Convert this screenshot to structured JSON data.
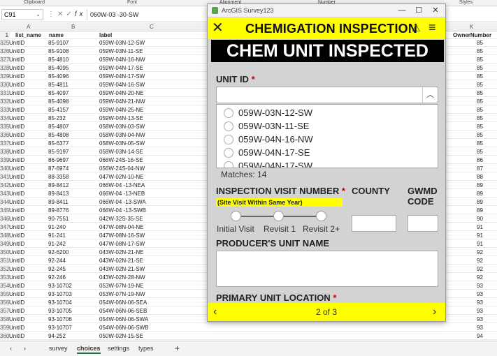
{
  "excel": {
    "ribbon_groups": [
      "Clipboard",
      "Font",
      "Alignment",
      "Number",
      "Styles"
    ],
    "name_box": "C91",
    "formula": "060W-03 -30-SW",
    "fx_label": "fx",
    "columns": [
      "A",
      "B",
      "C",
      "K"
    ],
    "header_row": {
      "rownum": "1",
      "list_name": "list_name",
      "name": "name",
      "label": "label",
      "owner": "OwnerNumber"
    },
    "rows": [
      {
        "n": "325",
        "a": "UnitID",
        "b": "85-9107",
        "c": "059W-03N-12-SW",
        "k": "85"
      },
      {
        "n": "326",
        "a": "UnitID",
        "b": "85-9108",
        "c": "059W-03N-11-SE",
        "k": "85"
      },
      {
        "n": "327",
        "a": "UnitID",
        "b": "85-4810",
        "c": "059W-04N-16-NW",
        "k": "85"
      },
      {
        "n": "328",
        "a": "UnitID",
        "b": "85-4095",
        "c": "059W-04N-17-SE",
        "k": "85"
      },
      {
        "n": "329",
        "a": "UnitID",
        "b": "85-4096",
        "c": "059W-04N-17-SW",
        "k": "85"
      },
      {
        "n": "330",
        "a": "UnitID",
        "b": "85-4811",
        "c": "059W-04N-16-SW",
        "k": "85"
      },
      {
        "n": "331",
        "a": "UnitID",
        "b": "85-4097",
        "c": "059W-04N-20-NE",
        "k": "85"
      },
      {
        "n": "332",
        "a": "UnitID",
        "b": "85-4098",
        "c": "059W-04N-21-NW",
        "k": "85"
      },
      {
        "n": "333",
        "a": "UnitID",
        "b": "85-4157",
        "c": "059W-04N-25-NE",
        "k": "85"
      },
      {
        "n": "334",
        "a": "UnitID",
        "b": "85-232",
        "c": "059W-04N-13-SE",
        "k": "85"
      },
      {
        "n": "335",
        "a": "UnitID",
        "b": "85-4807",
        "c": "058W-03N-03-SW",
        "k": "85"
      },
      {
        "n": "336",
        "a": "UnitID",
        "b": "85-4808",
        "c": "058W-03N-04-NW",
        "k": "85"
      },
      {
        "n": "337",
        "a": "UnitID",
        "b": "85-6377",
        "c": "058W-03N-05-SW",
        "k": "85"
      },
      {
        "n": "338",
        "a": "UnitID",
        "b": "85-9197",
        "c": "058W-03N-14-SE",
        "k": "85"
      },
      {
        "n": "339",
        "a": "UnitID",
        "b": "86-9697",
        "c": "066W-24S-16-SE",
        "k": "86"
      },
      {
        "n": "340",
        "a": "UnitID",
        "b": "87-6974",
        "c": "056W-24S-04-NW",
        "k": "87"
      },
      {
        "n": "341",
        "a": "UnitID",
        "b": "88-3358",
        "c": "047W-02N-10-NE",
        "k": "88"
      },
      {
        "n": "342",
        "a": "UnitID",
        "b": "89-8412",
        "c": "066W-04 -13-NEA",
        "k": "89"
      },
      {
        "n": "343",
        "a": "UnitID",
        "b": "89-8413",
        "c": "066W-04 -13-NEB",
        "k": "89"
      },
      {
        "n": "344",
        "a": "UnitID",
        "b": "89-8411",
        "c": "066W-04 -13-SWA",
        "k": "89"
      },
      {
        "n": "345",
        "a": "UnitID",
        "b": "89-8776",
        "c": "066W-04 -13-SWB",
        "k": "89"
      },
      {
        "n": "346",
        "a": "UnitID",
        "b": "90-7551",
        "c": "042W-32S-35-SE",
        "k": "90"
      },
      {
        "n": "347",
        "a": "UnitID",
        "b": "91-240",
        "c": "047W-08N-04-NE",
        "k": "91"
      },
      {
        "n": "348",
        "a": "UnitID",
        "b": "91-241",
        "c": "047W-08N-16-SW",
        "k": "91"
      },
      {
        "n": "349",
        "a": "UnitID",
        "b": "91-242",
        "c": "047W-08N-17-SW",
        "k": "91"
      },
      {
        "n": "350",
        "a": "UnitID",
        "b": "92-6200",
        "c": "043W-02N-21-NE",
        "k": "92"
      },
      {
        "n": "351",
        "a": "UnitID",
        "b": "92-244",
        "c": "043W-02N-21-SE",
        "k": "92"
      },
      {
        "n": "352",
        "a": "UnitID",
        "b": "92-245",
        "c": "043W-02N-21-SW",
        "k": "92"
      },
      {
        "n": "353",
        "a": "UnitID",
        "b": "92-246",
        "c": "043W-02N-28-NW",
        "k": "92"
      },
      {
        "n": "354",
        "a": "UnitID",
        "b": "93-10702",
        "c": "053W-07N-19-NE",
        "k": "93"
      },
      {
        "n": "355",
        "a": "UnitID",
        "b": "93-10703",
        "c": "053W-07N-19-NW",
        "k": "93"
      },
      {
        "n": "356",
        "a": "UnitID",
        "b": "93-10704",
        "c": "054W-06N-06-SEA",
        "k": "93"
      },
      {
        "n": "357",
        "a": "UnitID",
        "b": "93-10705",
        "c": "054W-06N-06-SEB",
        "k": "93"
      },
      {
        "n": "358",
        "a": "UnitID",
        "b": "93-10706",
        "c": "054W-06N-06-SWA",
        "k": "93"
      },
      {
        "n": "359",
        "a": "UnitID",
        "b": "93-10707",
        "c": "054W-06N-06-SWB",
        "k": "93"
      },
      {
        "n": "360",
        "a": "UnitID",
        "b": "94-252",
        "c": "050W-02N-15-SE",
        "k": "94"
      }
    ],
    "sheet_tabs": [
      "survey",
      "choices",
      "settings",
      "types"
    ],
    "active_tab": "choices",
    "add_sheet": "+"
  },
  "survey": {
    "window_title": "ArcGIS Survey123",
    "header_title": "CHEMIGATION INSPECTION",
    "banner": "CHEM UNIT INSPECTED",
    "unit_id_label": "UNIT ID",
    "required_mark": "*",
    "options": [
      "059W-03N-12-SW",
      "059W-03N-11-SE",
      "059W-04N-16-NW",
      "059W-04N-17-SE",
      "059W-04N-17-SW"
    ],
    "matches": "Matches: 14",
    "visit_label": "INSPECTION VISIT NUMBER",
    "visit_note": "(Site Visit Within Same Year)",
    "visit_ticks": [
      "Initial Visit",
      "Revisit 1",
      "Revisit 2+"
    ],
    "county_label": "COUNTY",
    "gwmd_label_1": "GWMD",
    "gwmd_label_2": "CODE",
    "producer_label": "PRODUCER'S UNIT NAME",
    "location_label": "PRIMARY UNIT LOCATION",
    "pager": "2 of 3",
    "accent_color": "#ffff00",
    "required_color": "#d40000"
  }
}
